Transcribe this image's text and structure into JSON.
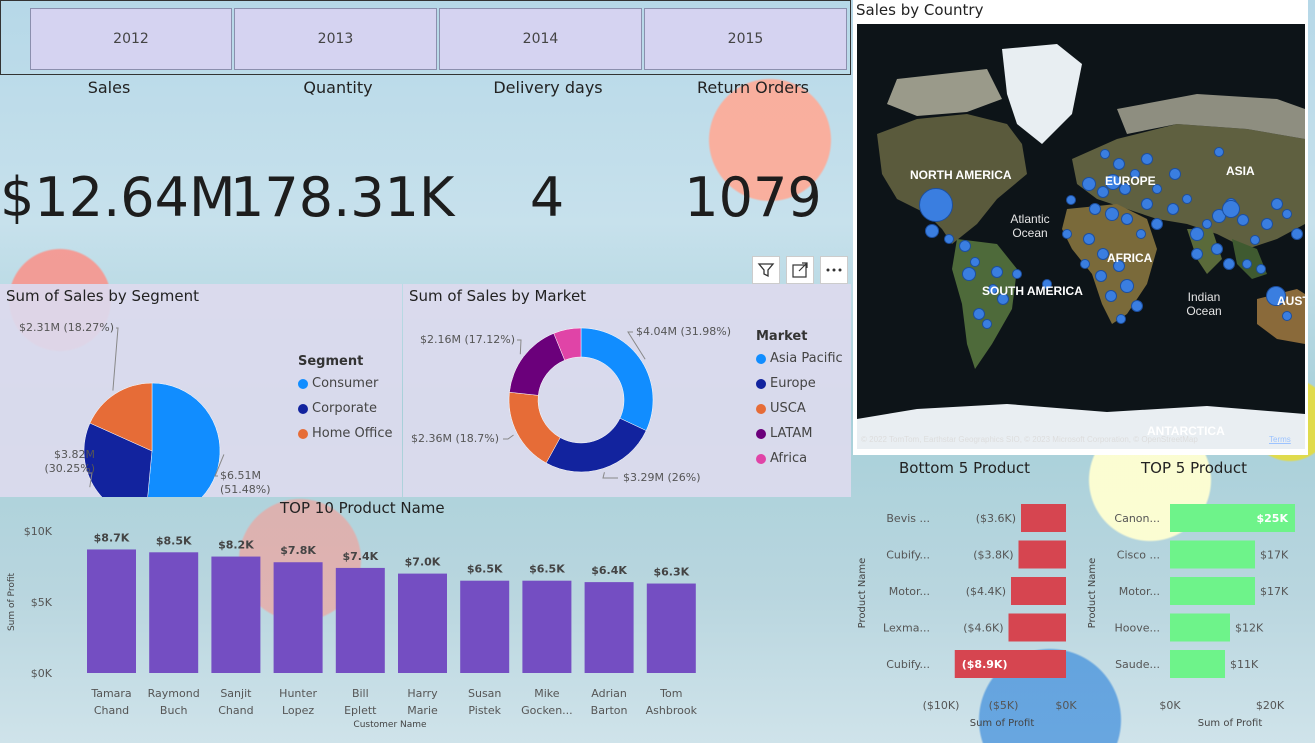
{
  "slicer": {
    "years": [
      "2012",
      "2013",
      "2014",
      "2015"
    ]
  },
  "kpis": [
    {
      "label": "Sales",
      "value": "$12.64M"
    },
    {
      "label": "Quantity",
      "value": "178.31K"
    },
    {
      "label": "Delivery days",
      "value": "4"
    },
    {
      "label": "Return Orders",
      "value": "1079"
    }
  ],
  "colors": {
    "blue": "#118dff",
    "navy": "#12239e",
    "orange": "#e66c37",
    "purple": "#6b007b",
    "pink": "#e044a7",
    "bar": "#744ec2",
    "red": "#d64550",
    "green": "#6ef38a"
  },
  "map": {
    "title": "Sales by Country",
    "continents": [
      "NORTH AMERICA",
      "EUROPE",
      "ASIA",
      "AFRICA",
      "SOUTH AMERICA",
      "AUSTR",
      "ANTARCTICA"
    ],
    "oceans": [
      "Atlantic Ocean",
      "Indian Ocean"
    ],
    "attribution": "© 2022 TomTom, Earthstar Geographics SIO, © 2023 Microsoft Corporation, © OpenStreetMap",
    "terms": "Terms"
  },
  "chart_data": [
    {
      "type": "pie",
      "title": "Sum of Sales by Segment",
      "legend_title": "Segment",
      "slices": [
        {
          "name": "Consumer",
          "value": 6.51,
          "label": "$6.51M (51.48%)",
          "color": "#118dff"
        },
        {
          "name": "Corporate",
          "value": 3.82,
          "label": "$3.82M (30.25%)",
          "color": "#12239e"
        },
        {
          "name": "Home Office",
          "value": 2.31,
          "label": "$2.31M (18.27%)",
          "color": "#e66c37"
        }
      ]
    },
    {
      "type": "pie",
      "title": "Sum of Sales by Market",
      "legend_title": "Market",
      "slices": [
        {
          "name": "Asia Pacific",
          "value": 4.04,
          "label": "$4.04M (31.98%)",
          "color": "#118dff"
        },
        {
          "name": "Europe",
          "value": 3.29,
          "label": "$3.29M (26%)",
          "color": "#12239e"
        },
        {
          "name": "USCA",
          "value": 2.36,
          "label": "$2.36M (18.7%)",
          "color": "#e66c37"
        },
        {
          "name": "LATAM",
          "value": 2.16,
          "label": "$2.16M (17.12%)",
          "color": "#6b007b"
        },
        {
          "name": "Africa",
          "value": 0.78,
          "label": "",
          "color": "#e044a7"
        }
      ]
    },
    {
      "type": "bar",
      "title": "TOP 10 Product Name",
      "xlabel": "Customer Name",
      "ylabel": "Sum of Profit",
      "categories": [
        "Tamara Chand",
        "Raymond Buch",
        "Sanjit Chand",
        "Hunter Lopez",
        "Bill Eplett",
        "Harry Marie",
        "Susan Pistek",
        "Mike Gocken...",
        "Adrian Barton",
        "Tom Ashbrook"
      ],
      "values": [
        8.7,
        8.5,
        8.2,
        7.8,
        7.4,
        7.0,
        6.5,
        6.5,
        6.4,
        6.3
      ],
      "value_labels": [
        "$8.7K",
        "$8.5K",
        "$8.2K",
        "$7.8K",
        "$7.4K",
        "$7.0K",
        "$6.5K",
        "$6.5K",
        "$6.4K",
        "$6.3K"
      ],
      "yticks": [
        "$0K",
        "$5K",
        "$10K"
      ],
      "ylim": [
        0,
        10
      ],
      "color": "#744ec2"
    },
    {
      "type": "bar",
      "orientation": "horizontal",
      "title": "Bottom 5 Product",
      "xlabel": "Sum of Profit",
      "ylabel": "Product Name",
      "categories": [
        "Bevis ...",
        "Cubify...",
        "Motor...",
        "Lexma...",
        "Cubify..."
      ],
      "values": [
        -3.6,
        -3.8,
        -4.4,
        -4.6,
        -8.9
      ],
      "value_labels": [
        "($3.6K)",
        "($3.8K)",
        "($4.4K)",
        "($4.6K)",
        "($8.9K)"
      ],
      "xticks": [
        "($10K)",
        "($5K)",
        "$0K"
      ],
      "xlim": [
        -10,
        0
      ],
      "color": "#d64550"
    },
    {
      "type": "bar",
      "orientation": "horizontal",
      "title": "TOP 5 Product",
      "xlabel": "Sum of Profit",
      "ylabel": "Product Name",
      "categories": [
        "Canon...",
        "Cisco ...",
        "Motor...",
        "Hoove...",
        "Saude..."
      ],
      "values": [
        25,
        17,
        17,
        12,
        11
      ],
      "value_labels": [
        "$25K",
        "$17K",
        "$17K",
        "$12K",
        "$11K"
      ],
      "xticks": [
        "$0K",
        "$20K"
      ],
      "xlim": [
        0,
        28
      ],
      "color": "#6ef38a"
    }
  ]
}
